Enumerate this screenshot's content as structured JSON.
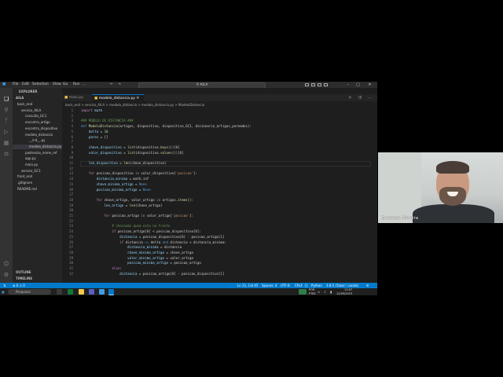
{
  "titlebar": {
    "menus": [
      "File",
      "Edit",
      "Selection",
      "View",
      "Go",
      "Run",
      "..."
    ],
    "search": "AILA"
  },
  "sidebar": {
    "header": "EXPLORER",
    "section": "AILA",
    "items": [
      {
        "label": "back_end",
        "indent": 0
      },
      {
        "label": "servico_AILA",
        "indent": 1
      },
      {
        "label": "consulta_GC1",
        "indent": 2
      },
      {
        "label": "encontra_artigo",
        "indent": 2
      },
      {
        "label": "encontra_dispositivo",
        "indent": 2
      },
      {
        "label": "modelo_distancia",
        "indent": 2
      },
      {
        "label": "__init__.py",
        "indent": 3
      },
      {
        "label": "modelo_distancia.py",
        "indent": 3,
        "selected": true
      },
      {
        "label": "padroniza_nome_ref",
        "indent": 2
      },
      {
        "label": "app.py",
        "indent": 2
      },
      {
        "label": "main.py",
        "indent": 2
      },
      {
        "label": "servico_GC1",
        "indent": 1
      },
      {
        "label": "front_end",
        "indent": 0
      },
      {
        "label": ".gitignore",
        "indent": 0
      },
      {
        "label": "README.md",
        "indent": 0
      }
    ],
    "outline": "OUTLINE",
    "timeline": "TIMELINE"
  },
  "tabs": [
    {
      "label": "main.py",
      "active": false
    },
    {
      "label": "modelo_distancia.py",
      "active": true
    }
  ],
  "breadcrumb": "back_end > servico_AILA > modelo_distancia > modelo_distancia.py > ModeloDistancia",
  "code": {
    "start_line": 1,
    "lines": [
      [
        [
          "import",
          "ctl"
        ],
        [
          " math",
          "var"
        ]
      ],
      [],
      [
        [
          "### MODELO DE DISTANCIA ###",
          "cm"
        ]
      ],
      [
        [
          "def",
          "kw"
        ],
        [
          " ",
          ""
        ],
        [
          "ModeloDistancia",
          "fn"
        ],
        [
          "(artigos, dispositivo, dispositivo_GC1, dicionario_artigos_pareados):",
          ""
        ]
      ],
      [
        [
          "    delta",
          "var"
        ],
        [
          " = ",
          ""
        ],
        [
          "10",
          "num"
        ]
      ],
      [
        [
          "    pares",
          "var"
        ],
        [
          " = []",
          ""
        ]
      ],
      [],
      [
        [
          "    chave_dispositivo",
          "var"
        ],
        [
          " = ",
          ""
        ],
        [
          "list",
          "fn"
        ],
        [
          "(dispositivo.",
          ""
        ],
        [
          "keys",
          "fn"
        ],
        [
          "())[",
          ""
        ],
        [
          "0",
          "num"
        ],
        [
          "]",
          ""
        ]
      ],
      [
        [
          "    valor_dispositivo",
          "var"
        ],
        [
          " = ",
          ""
        ],
        [
          "list",
          "fn"
        ],
        [
          "(dispositivo.",
          ""
        ],
        [
          "values",
          "fn"
        ],
        [
          "())[",
          ""
        ],
        [
          "0",
          "num"
        ],
        [
          "]",
          ""
        ]
      ],
      [],
      [
        [
          "    len_dispositivo",
          "var"
        ],
        [
          " = ",
          ""
        ],
        [
          "len",
          "fn"
        ],
        [
          "(chave_dispositivo)",
          ""
        ]
      ],
      [],
      [
        [
          "    ",
          ""
        ],
        [
          "for",
          "ctl"
        ],
        [
          " posicao_dispositivo ",
          ""
        ],
        [
          "in",
          "ctl"
        ],
        [
          " valor_dispositivo[",
          ""
        ],
        [
          "'posicao'",
          "str"
        ],
        [
          "]:",
          ""
        ]
      ],
      [
        [
          "        distancia_minima",
          "var"
        ],
        [
          " = math.inf",
          ""
        ]
      ],
      [
        [
          "        chave_minima_artigo",
          "var"
        ],
        [
          " = ",
          ""
        ],
        [
          "None",
          "kw"
        ]
      ],
      [
        [
          "        posicao_minima_artigo",
          "var"
        ],
        [
          " = ",
          ""
        ],
        [
          "None",
          "kw"
        ]
      ],
      [],
      [
        [
          "        ",
          ""
        ],
        [
          "for",
          "ctl"
        ],
        [
          " chave_artigo, valor_artigo ",
          ""
        ],
        [
          "in",
          "ctl"
        ],
        [
          " artigos.",
          ""
        ],
        [
          "items",
          "fn"
        ],
        [
          "():",
          ""
        ]
      ],
      [
        [
          "            len_artigo",
          "var"
        ],
        [
          " = ",
          ""
        ],
        [
          "len",
          "fn"
        ],
        [
          "(chave_artigo)",
          ""
        ]
      ],
      [],
      [
        [
          "            ",
          ""
        ],
        [
          "for",
          "ctl"
        ],
        [
          " posicao_artigo ",
          ""
        ],
        [
          "in",
          "ctl"
        ],
        [
          " valor_artigo[",
          ""
        ],
        [
          "'posicao'",
          "str"
        ],
        [
          "]:",
          ""
        ]
      ],
      [],
      [
        [
          "                # checando quem esta na frente",
          "cm"
        ]
      ],
      [
        [
          "                ",
          ""
        ],
        [
          "if",
          "ctl"
        ],
        [
          " posicao_artigo[",
          ""
        ],
        [
          "0",
          "num"
        ],
        [
          "] < posicao_dispositivo[",
          ""
        ],
        [
          "0",
          "num"
        ],
        [
          "]:",
          ""
        ]
      ],
      [
        [
          "                    distancia",
          "var"
        ],
        [
          " = posicao_dispositivo[",
          ""
        ],
        [
          "0",
          "num"
        ],
        [
          "] - posicao_artigo[",
          ""
        ],
        [
          "1",
          "num"
        ],
        [
          "]",
          ""
        ]
      ],
      [
        [
          "                    ",
          ""
        ],
        [
          "if",
          "ctl"
        ],
        [
          " distancia ",
          ""
        ],
        [
          "<=",
          "kw"
        ],
        [
          " delta ",
          ""
        ],
        [
          "and",
          "kw"
        ],
        [
          " distancia < distancia_minima:",
          ""
        ]
      ],
      [
        [
          "                        distancia_minima",
          "var"
        ],
        [
          " = distancia",
          ""
        ]
      ],
      [
        [
          "                        chave_minima_artigo",
          "var"
        ],
        [
          " = chave_artigo",
          ""
        ]
      ],
      [
        [
          "                        valor_minimo_artigo",
          "var"
        ],
        [
          " = valor_artigo",
          ""
        ]
      ],
      [
        [
          "                        posicao_minima_artigo",
          "var"
        ],
        [
          " = posicao_artigo",
          ""
        ]
      ],
      [
        [
          "                ",
          ""
        ],
        [
          "else",
          "ctl"
        ],
        [
          ":",
          ""
        ]
      ],
      [
        [
          "                    distancia",
          "var"
        ],
        [
          " = posicao_artigo[",
          ""
        ],
        [
          "0",
          "num"
        ],
        [
          "] - posicao_dispositivo[",
          ""
        ],
        [
          "1",
          "num"
        ],
        [
          "]",
          ""
        ]
      ]
    ]
  },
  "statusbar": {
    "position": "Ln 11, Col 45",
    "spaces": "Spaces: 4",
    "encoding": "UTF-8",
    "eol": "CRLF",
    "language": "Python",
    "interpreter": "3.8.5 ('base': conda)"
  },
  "taskbar": {
    "search": "Pesquisar",
    "lang": "POR",
    "region": "PTB2",
    "time": "10:07",
    "date": "12/09/2023"
  },
  "webcam": {
    "name": "Emerson Oliveira"
  },
  "colors": {
    "accent": "#007acc",
    "editor_bg": "#1e1e1e",
    "sidebar_bg": "#252526",
    "activity_bg": "#333333"
  }
}
